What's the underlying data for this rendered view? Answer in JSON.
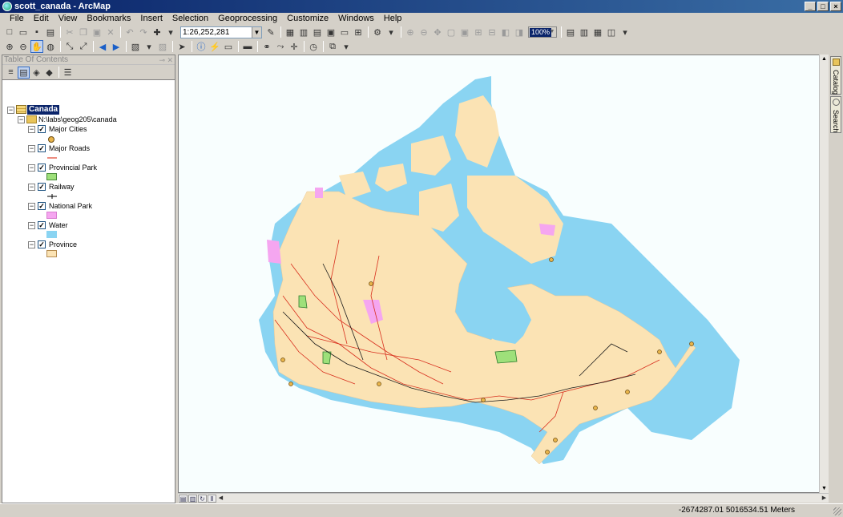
{
  "window": {
    "title": "scott_canada - ArcMap",
    "controls": [
      "_",
      "□",
      "×"
    ]
  },
  "menus": [
    "File",
    "Edit",
    "View",
    "Bookmarks",
    "Insert",
    "Selection",
    "Geoprocessing",
    "Customize",
    "Windows",
    "Help"
  ],
  "toolbar": {
    "scale": "1:26,252,281",
    "zoom_percent": "100%"
  },
  "toc": {
    "title": "Table Of Contents",
    "data_frame": "Canada",
    "folder_path": "N:\\labs\\geog205\\canada",
    "layers": [
      {
        "name": "Major Cities",
        "checked": true,
        "symbol": "point",
        "color": "#e8b44a"
      },
      {
        "name": "Major Roads",
        "checked": true,
        "symbol": "line",
        "color": "#e0402a"
      },
      {
        "name": "Provincial  Park",
        "checked": true,
        "symbol": "polygon",
        "color": "#9ee07a"
      },
      {
        "name": "Railway",
        "checked": true,
        "symbol": "railway",
        "color": "#000000"
      },
      {
        "name": "National Park",
        "checked": true,
        "symbol": "polygon",
        "color": "#f5a6f0"
      },
      {
        "name": "Water",
        "checked": true,
        "symbol": "polygon",
        "color": "#8ad4f2"
      },
      {
        "name": "Province",
        "checked": true,
        "symbol": "polygon",
        "color": "#fbe3b4"
      }
    ]
  },
  "dock": {
    "catalog": "Catalog",
    "search": "Search"
  },
  "status": {
    "coords": "-2674287.01  5016534.51 Meters"
  },
  "map_colors": {
    "background": "#f8fefe",
    "water": "#8ad4f2",
    "land": "#fbe3b4",
    "roads": "#d8301e",
    "railway": "#1a1a1a",
    "parks": "#9ee07a",
    "national_parks": "#f5a6f0",
    "cities": "#e8b44a"
  }
}
